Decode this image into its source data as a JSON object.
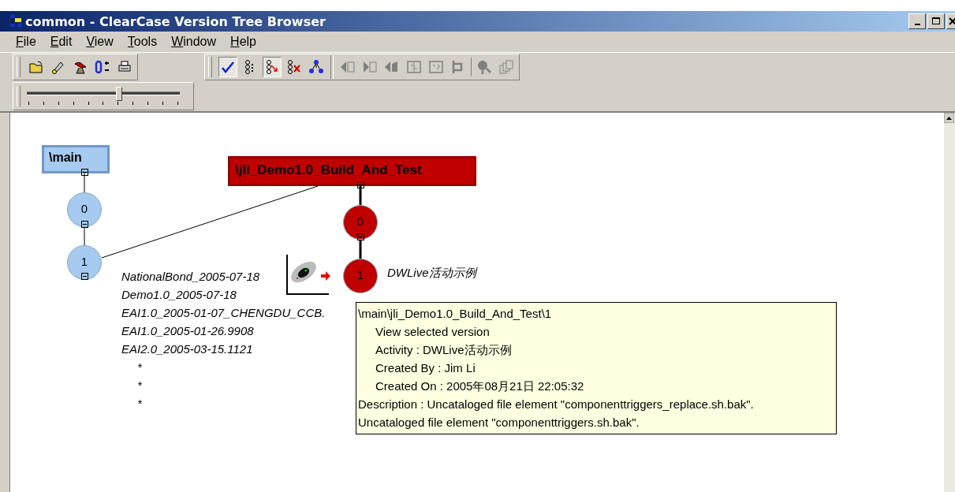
{
  "window": {
    "title": "common - ClearCase Version Tree Browser"
  },
  "menu": [
    {
      "label": "File"
    },
    {
      "label": "Edit"
    },
    {
      "label": "View"
    },
    {
      "label": "Tools"
    },
    {
      "label": "Window"
    },
    {
      "label": "Help"
    }
  ],
  "file_toolbar": [
    {
      "kind": "open"
    },
    {
      "kind": "flashlight"
    },
    {
      "kind": "bird"
    },
    {
      "kind": "compare"
    },
    {
      "kind": "print"
    }
  ],
  "tree_toolbar": [
    {
      "kind": "check",
      "pressed": true
    },
    {
      "kind": "list",
      "pressed": false
    },
    {
      "kind": "merge-arrows",
      "pressed": true
    },
    {
      "kind": "remove",
      "pressed": false
    },
    {
      "kind": "graph",
      "pressed": false
    }
  ],
  "action_toolbar": [
    {
      "kind": "back",
      "disabled": true
    },
    {
      "kind": "forward",
      "disabled": true
    },
    {
      "kind": "annotate",
      "disabled": true
    },
    {
      "kind": "diff",
      "disabled": true
    },
    {
      "kind": "diff-query",
      "disabled": true
    },
    {
      "kind": "branch",
      "disabled": true
    },
    {
      "kind": "info",
      "disabled": true
    },
    {
      "kind": "copies",
      "disabled": true
    }
  ],
  "zoom_slider": {
    "level": 0.6
  },
  "tree": {
    "branches": [
      {
        "name": "\\main",
        "color": "#a6caf0",
        "versions": [
          {
            "number": "0"
          },
          {
            "number": "1",
            "labels": [
              "NationalBond_2005-07-18",
              "Demo1.0_2005-07-18",
              "EAI1.0_2005-01-07_CHENGDU_CCB.",
              "EAI1.0_2005-01-26.9908",
              "EAI2.0_2005-03-15.1121",
              "*",
              "*",
              "*"
            ]
          }
        ]
      },
      {
        "name": "\\jli_Demo1.0_Build_And_Test",
        "color": "#c00000",
        "versions": [
          {
            "number": "0"
          },
          {
            "number": "1",
            "activity": "DWLive活动示例"
          }
        ]
      }
    ]
  },
  "tooltip": {
    "lines": [
      {
        "text": "\\main\\jli_Demo1.0_Build_And_Test\\1",
        "indent": false
      },
      {
        "text": "View selected version",
        "indent": true
      },
      {
        "text": "Activity : DWLive活动示例",
        "indent": true
      },
      {
        "text": "Created By : Jim Li",
        "indent": true
      },
      {
        "text": "Created On : 2005年08月21日 22:05:32",
        "indent": true
      },
      {
        "text": "Description : Uncataloged file element \"componenttriggers_replace.sh.bak\".",
        "indent": false
      },
      {
        "text": "Uncataloged file element \"componenttriggers.sh.bak\".",
        "indent": false
      }
    ]
  }
}
